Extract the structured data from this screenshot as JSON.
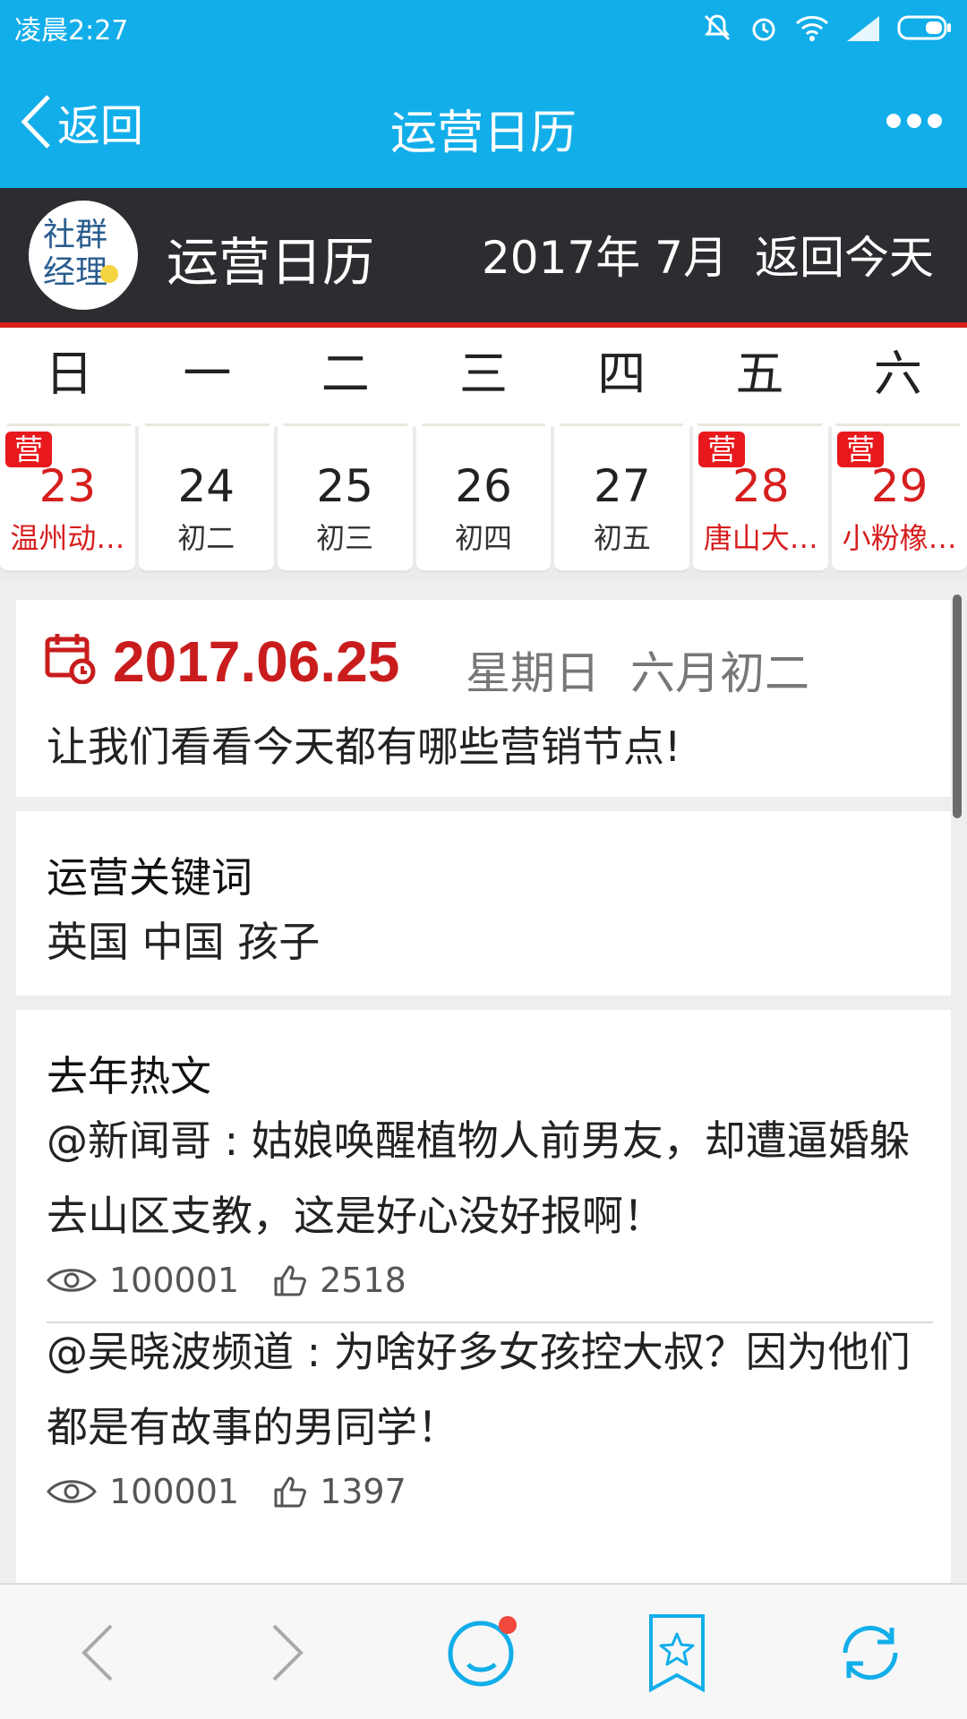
{
  "status_bar": {
    "time": "凌晨2:27"
  },
  "titlebar": {
    "back_label": "返回",
    "title": "运营日历"
  },
  "header": {
    "logo_text_line1": "社群",
    "logo_text_line2": "经理",
    "brand": "运营日历",
    "month": "2017年 7月",
    "today_label": "返回今天"
  },
  "weekdays": [
    "日",
    "一",
    "二",
    "三",
    "四",
    "五",
    "六"
  ],
  "dates": [
    {
      "num": "23",
      "sub": "温州动…",
      "badge": "营",
      "marked": true
    },
    {
      "num": "24",
      "sub": "初二",
      "badge": "",
      "marked": false
    },
    {
      "num": "25",
      "sub": "初三",
      "badge": "",
      "marked": false
    },
    {
      "num": "26",
      "sub": "初四",
      "badge": "",
      "marked": false
    },
    {
      "num": "27",
      "sub": "初五",
      "badge": "",
      "marked": false
    },
    {
      "num": "28",
      "sub": "唐山大…",
      "badge": "营",
      "marked": true
    },
    {
      "num": "29",
      "sub": "小粉橡…",
      "badge": "营",
      "marked": true
    }
  ],
  "today_card": {
    "date": "2017.06.25",
    "weekday": "星期日",
    "lunar": "六月初二",
    "desc": "让我们看看今天都有哪些营销节点!"
  },
  "keywords_card": {
    "title": "运营关键词",
    "keywords": "英国 中国 孩子"
  },
  "hot_card": {
    "title": "去年热文",
    "articles": [
      {
        "text": "@新闻哥 : 姑娘唤醒植物人前男友，却遭逼婚躲去山区支教，这是好心没好报啊！",
        "views": "100001",
        "likes": "2518"
      },
      {
        "text": "@吴晓波频道 : 为啥好多女孩控大叔？因为他们都是有故事的男同学！",
        "views": "100001",
        "likes": "1397"
      }
    ]
  },
  "colors": {
    "primary": "#12aeea",
    "header_dark": "#2c2d30",
    "accent_red": "#d71e1e"
  }
}
